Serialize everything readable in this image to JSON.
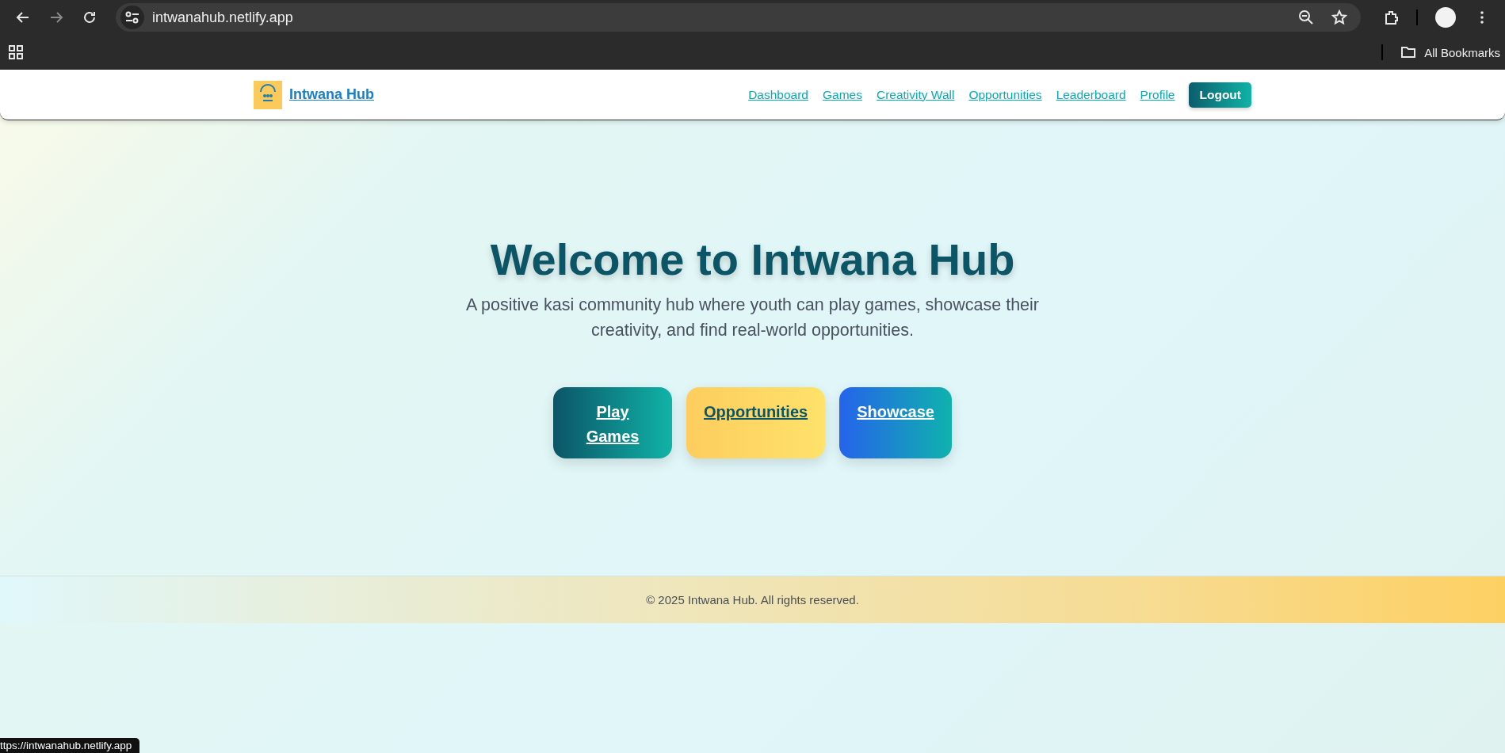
{
  "browser": {
    "url": "intwanahub.netlify.app",
    "bookmarks_label": "All Bookmarks",
    "status_url": "ttps://intwanahub.netlify.app"
  },
  "nav": {
    "brand": "Intwana Hub",
    "links": [
      "Dashboard",
      "Games",
      "Creativity Wall",
      "Opportunities",
      "Leaderboard",
      "Profile"
    ],
    "logout": "Logout"
  },
  "hero": {
    "title": "Welcome to Intwana Hub",
    "subtitle": "A positive kasi community hub where youth can play games, showcase their creativity, and find real-world opportunities.",
    "buttons": [
      {
        "label": "Play Games",
        "kind": "primary"
      },
      {
        "label": "Opportunities",
        "kind": "accent"
      },
      {
        "label": "Showcase",
        "kind": "secondary"
      }
    ]
  },
  "footer": {
    "text": "© 2025 Intwana Hub. All rights reserved."
  }
}
